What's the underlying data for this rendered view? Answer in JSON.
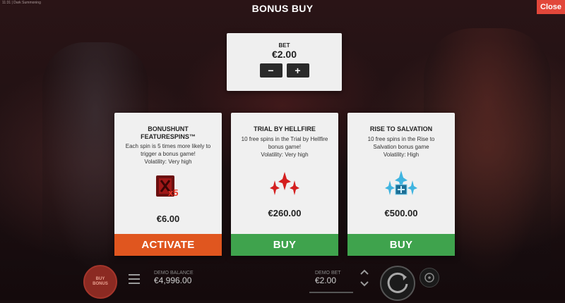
{
  "header": {
    "window_title": "11:31 | Dark Summoning",
    "title": "BONUS BUY",
    "close_label": "Close"
  },
  "bet": {
    "label": "BET",
    "value": "€2.00",
    "minus_label": "−",
    "plus_label": "+"
  },
  "cards": [
    {
      "title_line1": "BONUSHUNT",
      "title_line2": "FEATURESPINS™",
      "desc": [
        "Each spin is 5 times more likely to",
        "trigger a bonus game!",
        "Volatility: Very high"
      ],
      "icon": "bonushunt-x5-icon",
      "icon_text": "x5",
      "price": "€6.00",
      "action": "ACTIVATE",
      "action_color": "#e0561f"
    },
    {
      "title_line1": "TRIAL BY HELLFIRE",
      "title_line2": "",
      "desc": [
        "10 free spins in the Trial by Hellfire",
        "bonus game!",
        "Volatility: Very high"
      ],
      "icon": "red-arrows-icon",
      "price": "€260.00",
      "action": "BUY",
      "action_color": "#3fa34d"
    },
    {
      "title_line1": "RISE TO SALVATION",
      "title_line2": "",
      "desc": [
        "10 free spins in the Rise to",
        "Salvation bonus game",
        "Volatility: High"
      ],
      "icon": "blue-arrows-icon",
      "price": "€500.00",
      "action": "BUY",
      "action_color": "#3fa34d"
    }
  ],
  "hud": {
    "buy_bonus_line1": "BUY",
    "buy_bonus_line2": "BONUS",
    "demo_balance_label": "DEMO BALANCE",
    "demo_balance_value": "€4,996.00",
    "demo_bet_label": "DEMO BET",
    "demo_bet_value": "€2.00"
  },
  "colors": {
    "close": "#e2473a",
    "activate": "#e0561f",
    "buy": "#3fa34d"
  }
}
